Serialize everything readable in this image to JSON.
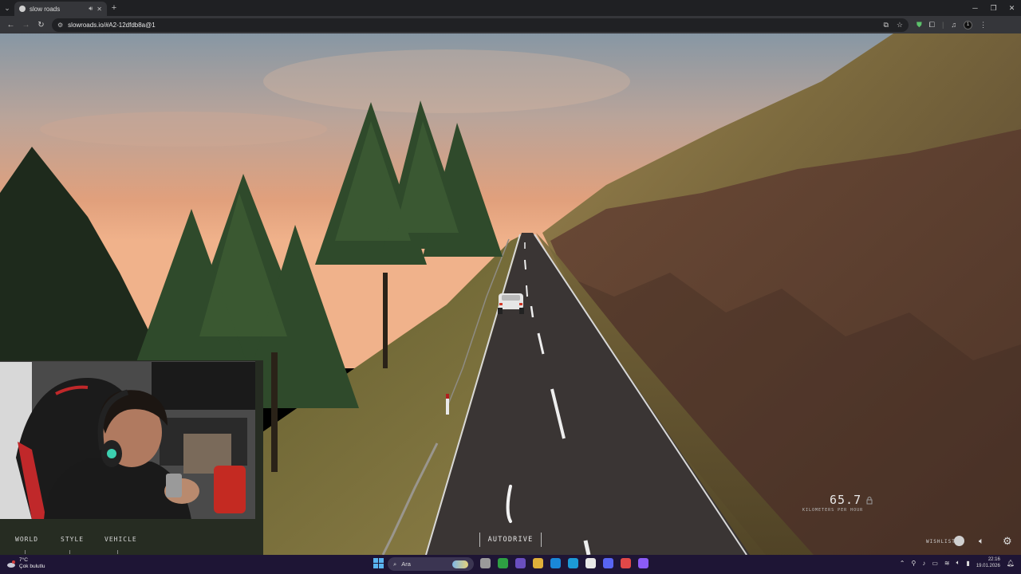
{
  "browser": {
    "tab_title": "slow roads",
    "url": "slowroads.io/#A2-12dfdb8a@1",
    "profile_initial": "1"
  },
  "game": {
    "menu": {
      "world": "WORLD",
      "style": "STYLE",
      "vehicle": "VEHICLE"
    },
    "autodrive_label": "AUTODRIVE",
    "speed_value": "65.7",
    "speed_unit": "KILOMETERS PER HOUR",
    "wishlist_label": "WISHLIST",
    "icons": [
      "lock-icon",
      "steam-icon",
      "volume-icon",
      "settings-icon"
    ]
  },
  "taskbar": {
    "weather_temp": "7°C",
    "weather_desc": "Çok bulutlu",
    "search_placeholder": "Ara",
    "time": "22:16",
    "date": "19.01.2026"
  },
  "colors": {
    "browser_bg": "#35363a",
    "taskbar_bg": "#1e1535",
    "road": "#3a3534",
    "hill": "#6b5535",
    "sky_top": "#8a9aa8",
    "sky_horizon": "#e8a27a"
  }
}
